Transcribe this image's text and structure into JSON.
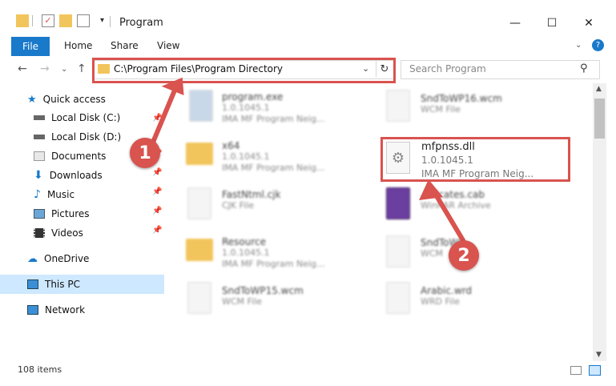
{
  "window": {
    "title": "Program"
  },
  "ribbon": {
    "tabs": [
      "File",
      "Home",
      "Share",
      "View"
    ]
  },
  "address": {
    "path": "C:\\Program Files\\Program Directory"
  },
  "search": {
    "placeholder": "Search Program"
  },
  "sidebar": {
    "items": [
      {
        "label": "Quick access",
        "icon": "star-icon"
      },
      {
        "label": "Local Disk (C:)",
        "icon": "disk-icon"
      },
      {
        "label": "Local Disk (D:)",
        "icon": "disk-icon"
      },
      {
        "label": "Documents",
        "icon": "documents-icon"
      },
      {
        "label": "Downloads",
        "icon": "download-icon"
      },
      {
        "label": "Music",
        "icon": "music-icon"
      },
      {
        "label": "Pictures",
        "icon": "pictures-icon"
      },
      {
        "label": "Videos",
        "icon": "videos-icon"
      },
      {
        "label": "OneDrive",
        "icon": "cloud-icon"
      },
      {
        "label": "This PC",
        "icon": "computer-icon"
      },
      {
        "label": "Network",
        "icon": "network-icon"
      }
    ]
  },
  "files": [
    {
      "name": "program.exe",
      "line2": "1.0.1045.1",
      "line3": "IMA MF Program Neig..."
    },
    {
      "name": "SndToWP16.wcm",
      "line2": "WCM File",
      "line3": ""
    },
    {
      "name": "x64",
      "line2": "1.0.1045.1",
      "line3": "IMA MF Program Neig..."
    },
    {
      "name": "mfpnss.dll",
      "line2": "1.0.1045.1",
      "line3": "IMA MF Program Neig..."
    },
    {
      "name": "FastNtml.cjk",
      "line2": "CJK File",
      "line3": ""
    },
    {
      "name": "...ificates.cab",
      "line2": "WinRAR Archive",
      "line3": ""
    },
    {
      "name": "Resource",
      "line2": "1.0.1045.1",
      "line3": "IMA MF Program Neig..."
    },
    {
      "name": "SndToWP...",
      "line2": "WCM",
      "line3": ""
    },
    {
      "name": "SndToWP15.wcm",
      "line2": "WCM File",
      "line3": ""
    },
    {
      "name": "Arabic.wrd",
      "line2": "WRD File",
      "line3": ""
    }
  ],
  "status": {
    "item_count": "108 items"
  },
  "callouts": [
    "1",
    "2"
  ],
  "colors": {
    "accent": "#1979ca",
    "highlight": "#d9534f",
    "selected": "#cde8ff"
  }
}
